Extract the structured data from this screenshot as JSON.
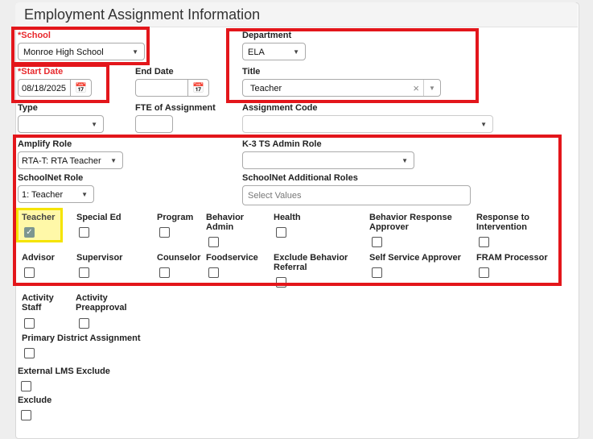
{
  "header": {
    "title": "Employment Assignment Information"
  },
  "fields": {
    "school": {
      "label": "School",
      "value": "Monroe High School",
      "required_mark": "*"
    },
    "department": {
      "label": "Department",
      "value": "ELA"
    },
    "start_date": {
      "label": "Start Date",
      "value": "08/18/2025",
      "required_mark": "*"
    },
    "end_date": {
      "label": "End Date",
      "value": ""
    },
    "title": {
      "label": "Title",
      "value": "Teacher"
    },
    "type": {
      "label": "Type",
      "value": ""
    },
    "fte": {
      "label": "FTE of Assignment",
      "value": ""
    },
    "assignment_code": {
      "label": "Assignment Code",
      "value": ""
    },
    "amplify_role": {
      "label": "Amplify Role",
      "value": "RTA-T: RTA Teacher"
    },
    "k3_role": {
      "label": "K-3 TS Admin Role",
      "value": ""
    },
    "schoolnet_role": {
      "label": "SchoolNet Role",
      "value": "1: Teacher"
    },
    "schoolnet_additional": {
      "label": "SchoolNet Additional Roles",
      "placeholder": "Select Values"
    }
  },
  "checkboxes": {
    "teacher": {
      "label": "Teacher",
      "checked": true
    },
    "special_ed": {
      "label": "Special Ed",
      "checked": false
    },
    "program": {
      "label": "Program",
      "checked": false
    },
    "behavior_admin": {
      "label": "Behavior Admin",
      "checked": false
    },
    "health": {
      "label": "Health",
      "checked": false
    },
    "behavior_response": {
      "label": "Behavior Response Approver",
      "checked": false
    },
    "rti": {
      "label": "Response to Intervention",
      "checked": false
    },
    "advisor": {
      "label": "Advisor",
      "checked": false
    },
    "supervisor": {
      "label": "Supervisor",
      "checked": false
    },
    "counselor": {
      "label": "Counselor",
      "checked": false
    },
    "foodservice": {
      "label": "Foodservice",
      "checked": false
    },
    "exclude_behavior": {
      "label": "Exclude Behavior Referral",
      "checked": false
    },
    "self_service": {
      "label": "Self Service Approver",
      "checked": false
    },
    "fram": {
      "label": "FRAM Processor",
      "checked": false
    },
    "activity_staff": {
      "label": "Activity Staff",
      "checked": false
    },
    "activity_preapproval": {
      "label": "Activity Preapproval",
      "checked": false
    },
    "primary_district": {
      "label": "Primary District Assignment",
      "checked": false
    },
    "external_lms": {
      "label": "External LMS Exclude",
      "checked": false
    },
    "exclude": {
      "label": "Exclude",
      "checked": false
    }
  },
  "icons": {
    "calendar": "calendar-icon",
    "clear": "×",
    "dropdown": "▼"
  }
}
